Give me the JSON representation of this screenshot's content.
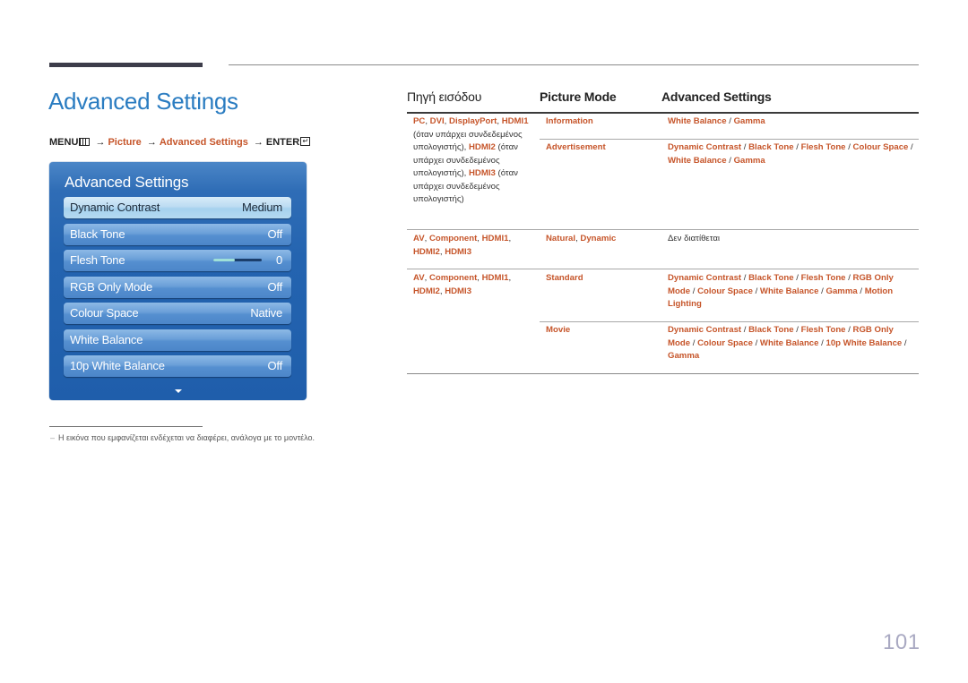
{
  "page": {
    "title": "Advanced Settings",
    "page_number": "101"
  },
  "breadcrumb": {
    "menu": "MENU",
    "menu_icon": "menu-grid-icon",
    "arrow": "→",
    "step1": "Picture",
    "step2": "Advanced Settings",
    "enter": "ENTER",
    "enter_icon": "enter-icon",
    "enter_glyph": "↵"
  },
  "osd": {
    "title": "Advanced Settings",
    "items": [
      {
        "label": "Dynamic Contrast",
        "value": "Medium",
        "selected": true
      },
      {
        "label": "Black Tone",
        "value": "Off"
      },
      {
        "label": "Flesh Tone",
        "value": "0",
        "slider_percent": 45
      },
      {
        "label": "RGB Only Mode",
        "value": "Off"
      },
      {
        "label": "Colour Space",
        "value": "Native"
      },
      {
        "label": "White Balance",
        "value": ""
      },
      {
        "label": "10p White Balance",
        "value": "Off"
      }
    ],
    "more_icon": "chevron-down-icon"
  },
  "table": {
    "headers": [
      "Πηγή εισόδου",
      "Picture Mode",
      "Advanced Settings"
    ],
    "rows": [
      {
        "source_parts": [
          {
            "t": "PC",
            "o": true
          },
          {
            "t": ", ",
            "o": false
          },
          {
            "t": "DVI",
            "o": true
          },
          {
            "t": ", ",
            "o": false
          },
          {
            "t": "DisplayPort",
            "o": true
          },
          {
            "t": ", ",
            "o": false
          },
          {
            "t": "HDMI1",
            "o": true
          },
          {
            "t": " (όταν υπάρχει συνδεδεμένος υπολογιστής), ",
            "o": false
          },
          {
            "t": "HDMI2",
            "o": true
          },
          {
            "t": " (όταν υπάρχει συνδεδεμένος υπολογιστής), ",
            "o": false
          },
          {
            "t": "HDMI3",
            "o": true
          },
          {
            "t": " (όταν υπάρχει συνδεδεμένος υπολογιστής)",
            "o": false
          }
        ],
        "modes": [
          {
            "mode": "Information",
            "settings": "White Balance / Gamma"
          },
          {
            "mode": "Advertisement",
            "settings": "Dynamic Contrast / Black Tone / Flesh Tone / Colour Space / White Balance / Gamma"
          }
        ]
      },
      {
        "source": "AV, Component, HDMI1, HDMI2, HDMI3",
        "modes": [
          {
            "mode": "Natural, Dynamic",
            "settings": "Δεν διατίθεται",
            "settings_plain": true
          }
        ]
      },
      {
        "source": "AV, Component, HDMI1, HDMI2, HDMI3",
        "modes": [
          {
            "mode": "Standard",
            "settings": "Dynamic Contrast / Black Tone / Flesh Tone / RGB Only Mode / Colour Space / White Balance / Gamma / Motion Lighting"
          },
          {
            "mode": "Movie",
            "settings": "Dynamic Contrast / Black Tone / Flesh Tone / RGB Only Mode / Colour Space / White Balance / 10p White Balance / Gamma"
          }
        ]
      }
    ]
  },
  "footnote": {
    "dash": "–",
    "text": "Η εικόνα που εμφανίζεται ενδέχεται να διαφέρει, ανάλογα με το μοντέλο."
  },
  "colors": {
    "title_blue": "#2a7cc1",
    "accent_orange": "#c6552a",
    "osd_blue": "#2464b0",
    "page_number": "#a9a9c2"
  }
}
